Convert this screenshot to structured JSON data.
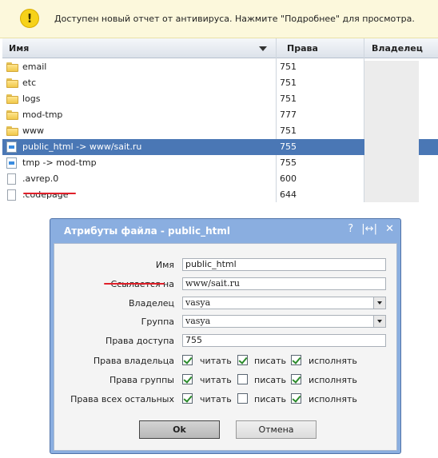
{
  "notice": {
    "icon": "info-icon",
    "text": "Доступен новый отчет от антивируса. Нажмите \"Подробнее\" для просмотра."
  },
  "table": {
    "columns": {
      "name": "Имя",
      "perms": "Права",
      "owner": "Владелец"
    },
    "rows": [
      {
        "name": "email",
        "perm": "751",
        "icon": "folder-icon"
      },
      {
        "name": "etc",
        "perm": "751",
        "icon": "folder-icon"
      },
      {
        "name": "logs",
        "perm": "751",
        "icon": "folder-icon"
      },
      {
        "name": "mod-tmp",
        "perm": "777",
        "icon": "folder-icon"
      },
      {
        "name": "www",
        "perm": "751",
        "icon": "folder-icon"
      },
      {
        "name": "public_html -> www/sait.ru",
        "perm": "755",
        "icon": "link-icon",
        "selected": true
      },
      {
        "name": "tmp -> mod-tmp",
        "perm": "755",
        "icon": "link-icon"
      },
      {
        "name": ".avrep.0",
        "perm": "600",
        "icon": "file-icon"
      },
      {
        "name": ".codepage",
        "perm": "644",
        "icon": "file-icon"
      }
    ]
  },
  "dialog": {
    "title": "Атрибуты файла - public_html",
    "icons": {
      "help": "?",
      "resize": "|↔|",
      "close": "✕"
    },
    "name_label": "Имя",
    "name_value": "public_html",
    "link_label": "Ссылается на",
    "link_value": "www/sait.ru",
    "owner_label": "Владелец",
    "owner_value": "vasya",
    "group_label": "Группа",
    "group_value": "vasya",
    "perms_label": "Права доступа",
    "perms_value": "755",
    "rights": {
      "read": "читать",
      "write": "писать",
      "exec": "исполнять",
      "owner_label": "Права владельца",
      "group_label": "Права группы",
      "others_label": "Права всех остальных",
      "owner": [
        true,
        true,
        true
      ],
      "group": [
        true,
        false,
        true
      ],
      "others": [
        true,
        false,
        true
      ]
    },
    "ok_label": "Ok",
    "cancel_label": "Отмена"
  },
  "colors": {
    "selected_row": "#4a77b5",
    "dialog_frame": "#8aaee0",
    "notice_bg": "#fcf8dc",
    "highlight_underline": "#e0202a"
  }
}
